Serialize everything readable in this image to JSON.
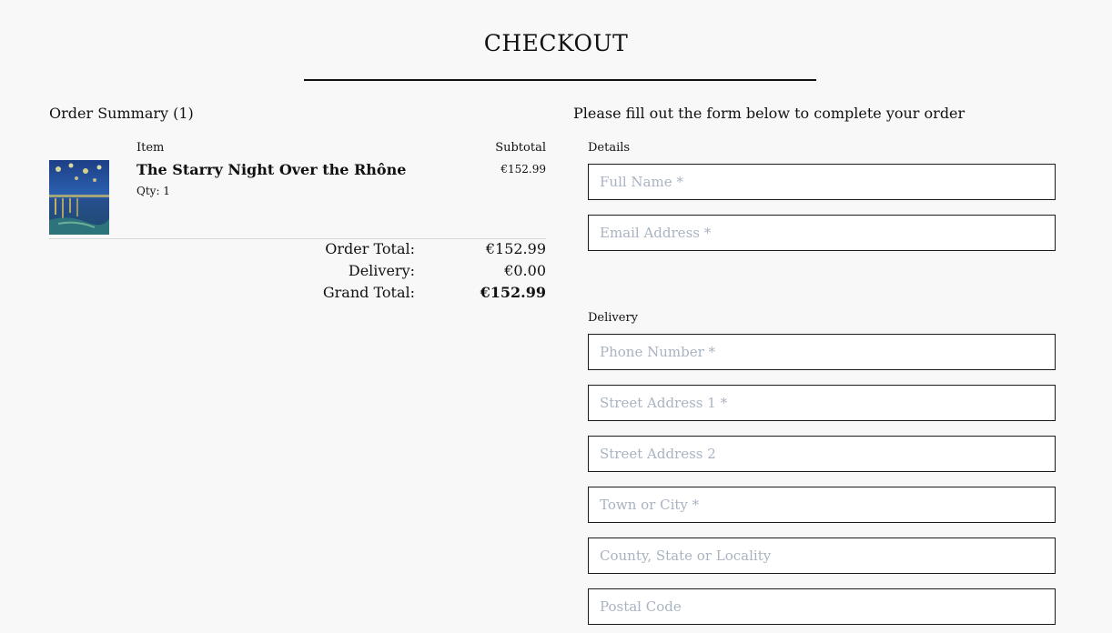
{
  "page": {
    "title": "CHECKOUT"
  },
  "summary": {
    "heading": "Order Summary (1)",
    "item_col_label": "Item",
    "subtotal_col_label": "Subtotal",
    "items": [
      {
        "name": "The Starry Night Over the Rhône",
        "qty": "Qty: 1",
        "subtotal": "€152.99",
        "thumbnail_icon": "starry-night-painting"
      }
    ],
    "order_total_label": "Order Total:",
    "order_total_value": "€152.99",
    "delivery_label": "Delivery:",
    "delivery_value": "€0.00",
    "grand_total_label": "Grand Total:",
    "grand_total_value": "€152.99"
  },
  "form": {
    "heading": "Please fill out the form below to complete your order",
    "details_label": "Details",
    "delivery_label": "Delivery",
    "full_name": {
      "value": "",
      "placeholder": "Full Name *"
    },
    "email": {
      "value": "",
      "placeholder": "Email Address *"
    },
    "phone": {
      "value": "",
      "placeholder": "Phone Number *"
    },
    "street1": {
      "value": "",
      "placeholder": "Street Address 1 *"
    },
    "street2": {
      "value": "",
      "placeholder": "Street Address 2"
    },
    "town": {
      "value": "",
      "placeholder": "Town or City *"
    },
    "county": {
      "value": "",
      "placeholder": "County, State or Locality"
    },
    "postcode": {
      "value": "",
      "placeholder": "Postal Code"
    }
  },
  "colors": {
    "background": "#f8f8f8",
    "text": "#111111",
    "placeholder": "#a9b3c1",
    "border": "#1a1a1a"
  }
}
